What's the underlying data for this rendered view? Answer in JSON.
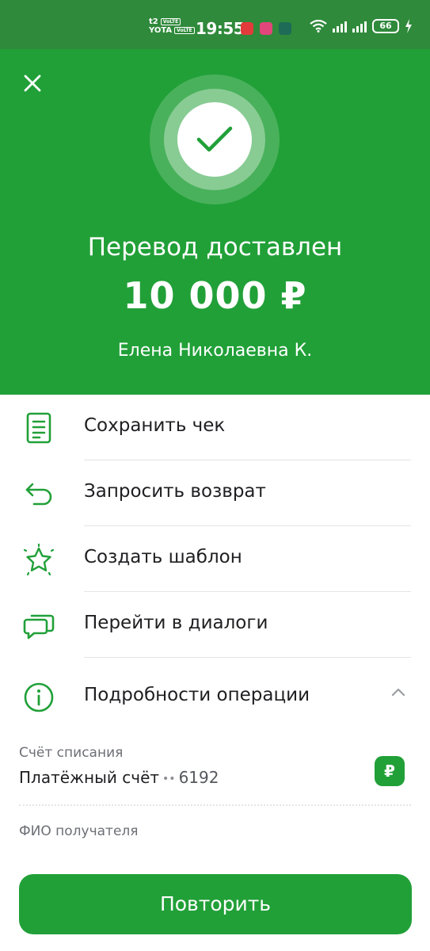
{
  "status_bar": {
    "carrier1": "t2",
    "carrier2": "YOTA",
    "volte": "VoLTE",
    "time": "19:55",
    "battery": "66"
  },
  "header": {
    "title": "Перевод доставлен",
    "amount": "10 000 ₽",
    "recipient": "Елена Николаевна К."
  },
  "actions": [
    {
      "label": "Сохранить чек",
      "icon": "receipt-icon"
    },
    {
      "label": "Запросить возврат",
      "icon": "return-arrow-icon"
    },
    {
      "label": "Создать шаблон",
      "icon": "star-template-icon"
    },
    {
      "label": "Перейти в диалоги",
      "icon": "chat-bubbles-icon"
    },
    {
      "label": "Подробности операции",
      "icon": "info-icon"
    }
  ],
  "details": {
    "account_label": "Счёт списания",
    "account_name": "Платёжный счёт",
    "account_dots": "••",
    "account_number": "6192",
    "currency_badge": "₽",
    "recipient_label": "ФИО получателя"
  },
  "bottom": {
    "repeat_label": "Повторить"
  },
  "colors": {
    "brand_green": "#21a038",
    "status_bar_green": "#2f8a3b",
    "text": "#1f1f22",
    "secondary_text": "#6c6f75"
  }
}
